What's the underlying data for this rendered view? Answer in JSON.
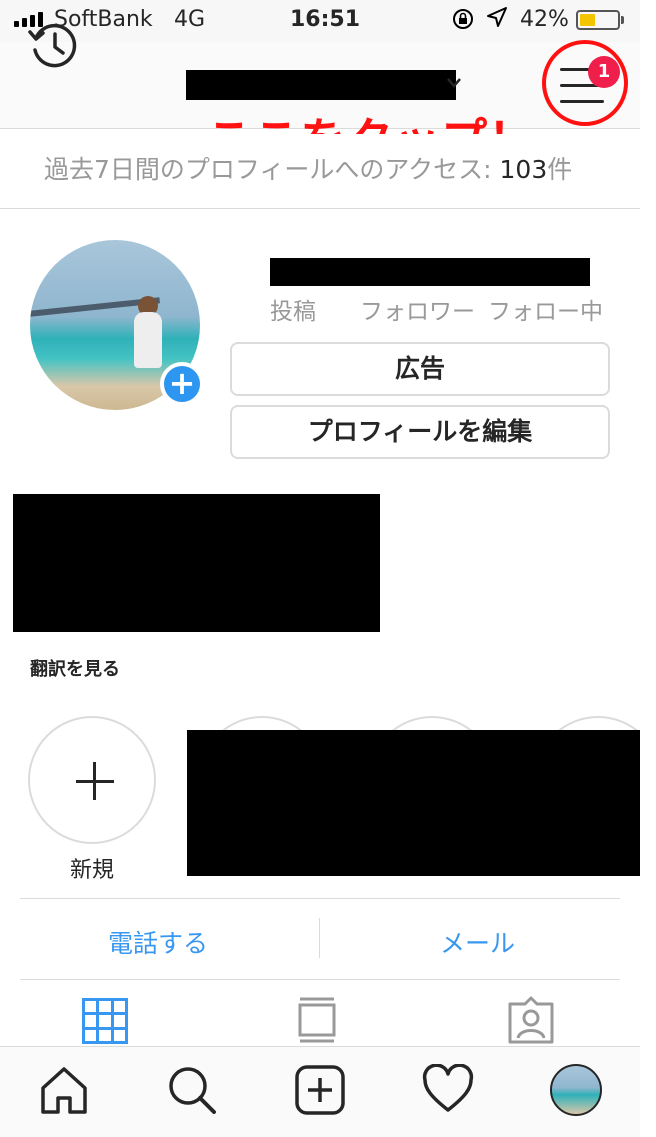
{
  "status_bar": {
    "carrier": "SoftBank",
    "network": "4G",
    "time": "16:51",
    "battery_percent": "42%",
    "battery_level": 0.42,
    "icons": [
      "signal-icon",
      "orientation-lock-icon",
      "location-icon",
      "battery-icon"
    ]
  },
  "header": {
    "menu_badge": "1",
    "annotation": "ここをタップ！"
  },
  "insight": {
    "text": "過去7日間のプロフィールへのアクセス: ",
    "count": "103",
    "unit": "件"
  },
  "profile": {
    "stats": {
      "posts": "投稿",
      "followers": "フォロワー",
      "following": "フォロー中"
    },
    "ad_button": "広告",
    "edit_button": "プロフィールを編集",
    "translate_link": "翻訳を見る"
  },
  "highlights": {
    "new_label": "新規"
  },
  "contact": {
    "call": "電話する",
    "mail": "メール"
  },
  "colors": {
    "accent_blue": "#3897f0",
    "annotation_red": "#ff1111",
    "badge_red": "#f01e4b",
    "add_blue": "#2d96f0"
  }
}
